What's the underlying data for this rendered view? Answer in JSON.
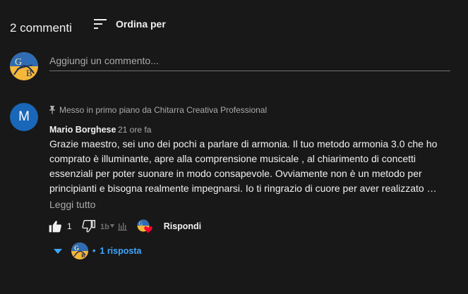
{
  "header": {
    "count_label": "2 commenti",
    "sort_label": "Ordina per"
  },
  "add_comment": {
    "placeholder": "Aggiungi un commento...",
    "avatar_letters": "G B"
  },
  "comment": {
    "avatar_letter": "M",
    "pinned_text": "Messo in primo piano da Chitarra Creativa Professional",
    "author": "Mario Borghese",
    "time": "21 ore fa",
    "text": "Grazie maestro, sei uno dei pochi a parlare di armonia. Il tuo metodo armonia 3.0 che ho comprato è illuminante, apre alla comprensione musicale , al chiarimento di concetti essenziali per poter suonare in modo consapevole. Ovviamente non è un metodo per principianti e bisogna realmente impegnarsi. Io ti ringrazio di cuore per aver realizzato …",
    "read_more": "Leggi tutto",
    "like_count": "1",
    "reply_label": "Rispondi"
  },
  "replies": {
    "separator": "•",
    "label": "1 risposta"
  },
  "colors": {
    "background": "#181818",
    "accent": "#3ea6ff",
    "avatar_blue": "#1a66b8",
    "heart": "#ff0033"
  },
  "icons": [
    "sort-icon",
    "pin-icon",
    "like-icon",
    "dislike-icon",
    "creator-boost-icon",
    "creator-heart-icon",
    "chevron-down-icon"
  ]
}
